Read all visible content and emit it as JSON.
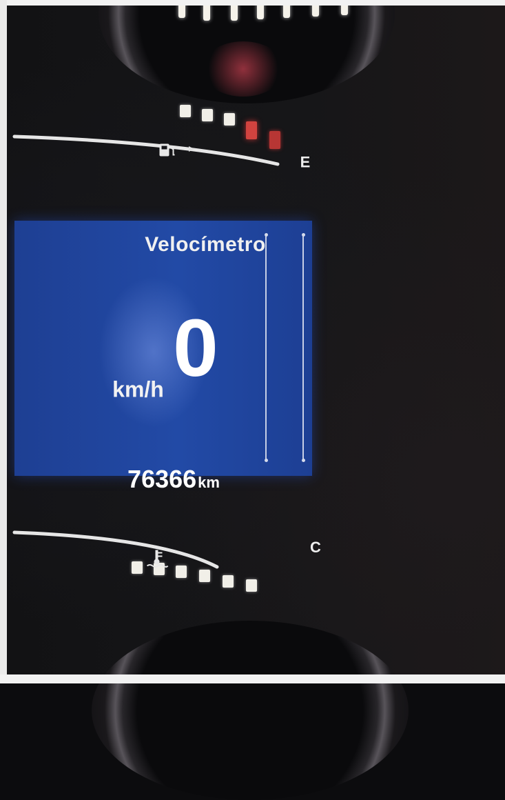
{
  "display": {
    "title": "Velocímetro",
    "speed_value": "0",
    "speed_unit": "km/h",
    "odometer_value": "76366",
    "odometer_unit": "km"
  },
  "fuel_gauge": {
    "empty_label": "E",
    "icon": "fuel-pump-icon",
    "segments_lit_red": 2,
    "segments_total": 5
  },
  "temp_gauge": {
    "cold_label": "C",
    "icon": "coolant-temperature-icon",
    "segments_total": 6
  },
  "colors": {
    "display_background": "#224aa6",
    "warning_red": "#d2433f",
    "segment_white": "#f1efe8"
  }
}
